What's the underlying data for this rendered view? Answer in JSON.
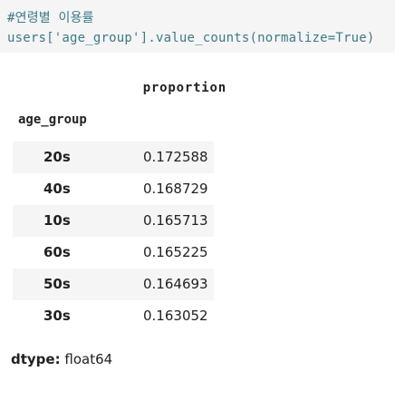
{
  "code_cell": {
    "comment": "#연령별 이용률",
    "code": "users['age_group'].value_counts(normalize=True)"
  },
  "output": {
    "column_header": "proportion",
    "index_name": "age_group",
    "rows": [
      {
        "index": "20s",
        "value": "0.172588"
      },
      {
        "index": "40s",
        "value": "0.168729"
      },
      {
        "index": "10s",
        "value": "0.165713"
      },
      {
        "index": "60s",
        "value": "0.165225"
      },
      {
        "index": "50s",
        "value": "0.164693"
      },
      {
        "index": "30s",
        "value": "0.163052"
      }
    ],
    "dtype_label": "dtype:",
    "dtype_value": "float64"
  }
}
